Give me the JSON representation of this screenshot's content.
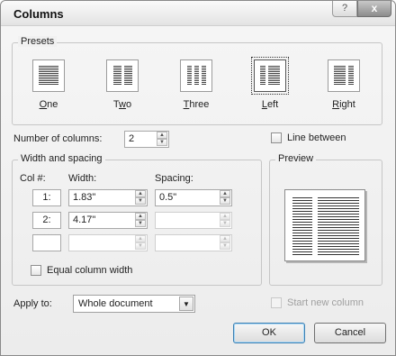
{
  "dialog": {
    "title": "Columns",
    "help_glyph": "?",
    "close_glyph": "x"
  },
  "presets": {
    "group_label": "Presets",
    "items": [
      {
        "label": "One",
        "mnemonic_index": 0
      },
      {
        "label": "Two",
        "mnemonic_index": 1
      },
      {
        "label": "Three",
        "mnemonic_index": 0
      },
      {
        "label": "Left",
        "mnemonic_index": 0,
        "selected": true
      },
      {
        "label": "Right",
        "mnemonic_index": 0
      }
    ]
  },
  "number_of_columns": {
    "label": "Number of columns:",
    "value": "2"
  },
  "line_between": {
    "label": "Line between",
    "checked": false
  },
  "width_spacing": {
    "group_label": "Width and spacing",
    "col_header": "Col #:",
    "width_header": "Width:",
    "spacing_header": "Spacing:",
    "rows": [
      {
        "col": "1:",
        "width": "1.83\"",
        "spacing": "0.5\""
      },
      {
        "col": "2:",
        "width": "4.17\"",
        "spacing": ""
      },
      {
        "col": "",
        "width": "",
        "spacing": ""
      }
    ],
    "equal_width_label": "Equal column width",
    "equal_width_checked": false
  },
  "preview": {
    "group_label": "Preview"
  },
  "apply_to": {
    "label": "Apply to:",
    "value": "Whole document"
  },
  "start_new_column": {
    "label": "Start new column",
    "enabled": false
  },
  "buttons": {
    "ok": "OK",
    "cancel": "Cancel"
  }
}
